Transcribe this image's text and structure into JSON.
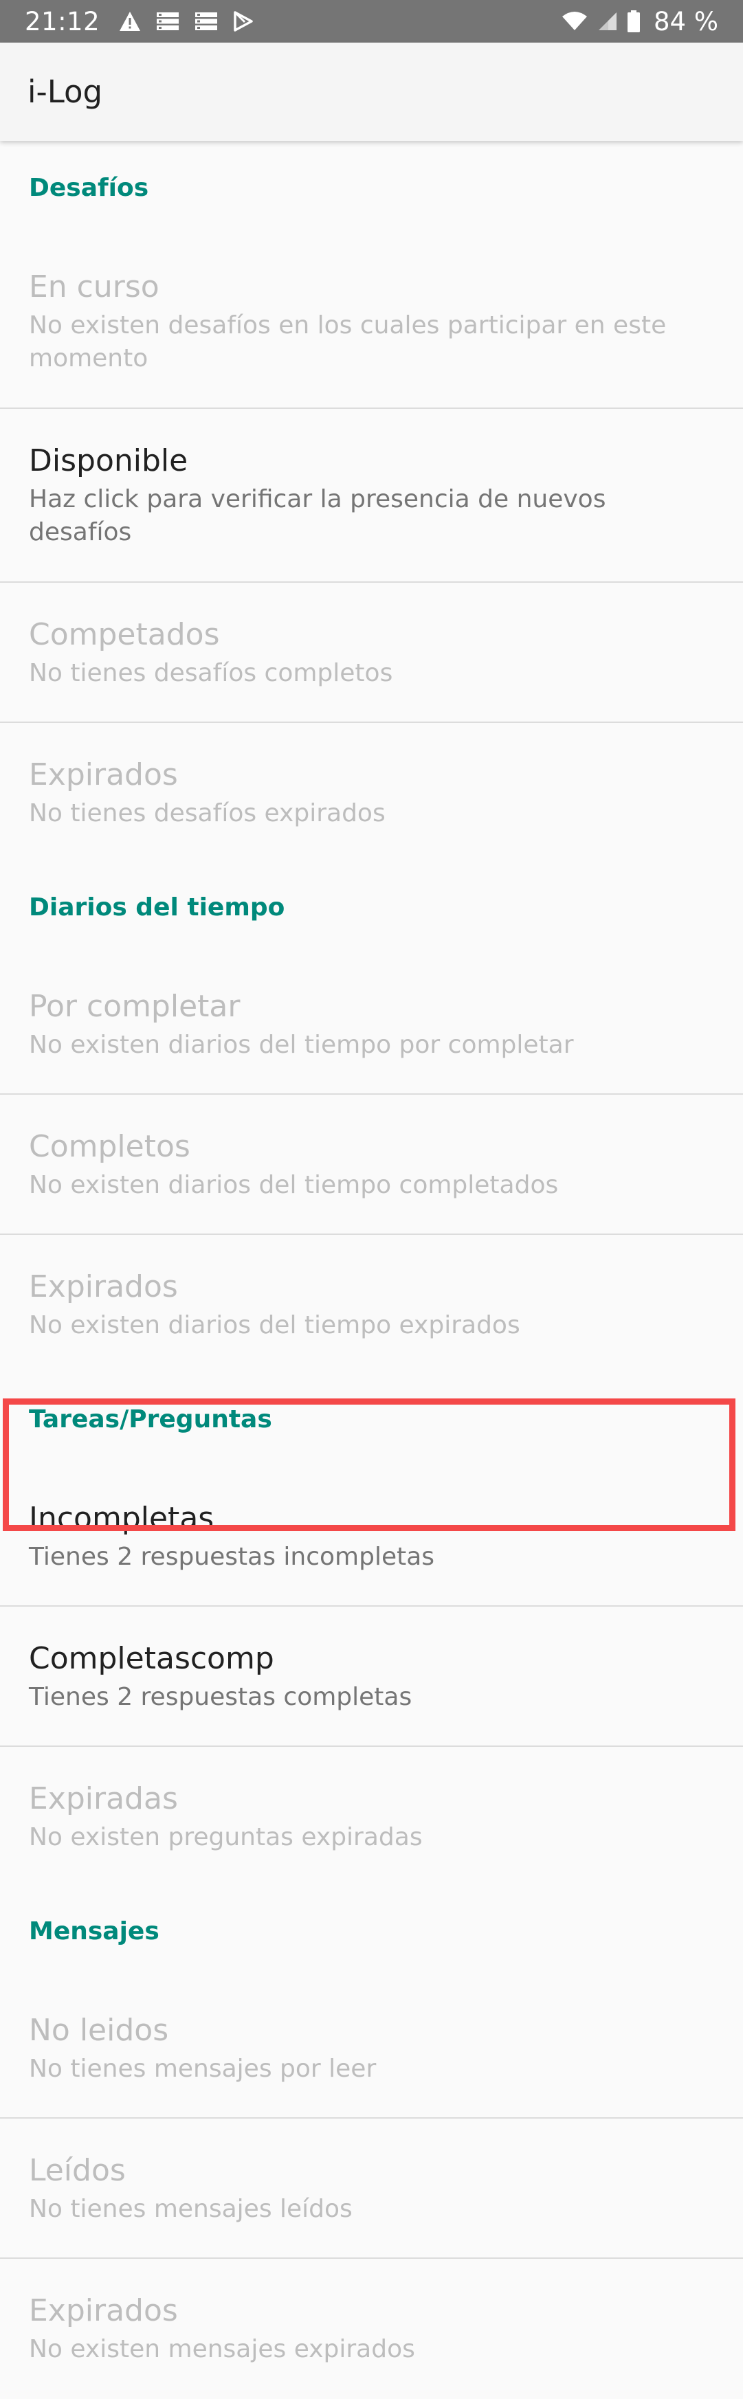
{
  "status_bar": {
    "time": "21:12",
    "battery": "84 %",
    "icons": [
      "warning-icon",
      "sim-icon",
      "sim-icon",
      "play-store-icon",
      "wifi-icon",
      "signal-icon",
      "battery-icon"
    ]
  },
  "app_bar": {
    "title": "i-Log"
  },
  "sections": {
    "challenges": {
      "header": "Desafíos",
      "in_progress": {
        "title": "En curso",
        "summary": "No existen desafíos en los cuales participar en este momento"
      },
      "available": {
        "title": "Disponible",
        "summary": "Haz click para verificar la presencia de nuevos desafíos"
      },
      "completed": {
        "title": "Competados",
        "summary": "No tienes desafíos completos"
      },
      "expired": {
        "title": "Expirados",
        "summary": "No tienes desafíos expirados"
      }
    },
    "time_diaries": {
      "header": "Diarios del tiempo",
      "to_complete": {
        "title": "Por completar",
        "summary": "No existen diarios del tiempo por completar"
      },
      "completed": {
        "title": "Completos",
        "summary": "No existen diarios del tiempo completados"
      },
      "expired": {
        "title": "Expirados",
        "summary": "No existen diarios del tiempo expirados"
      }
    },
    "tasks": {
      "header": "Tareas/Preguntas",
      "incomplete": {
        "title": "Incompletas",
        "summary": "Tienes 2 respuestas incompletas"
      },
      "complete": {
        "title": "Completascomp",
        "summary": "Tienes 2 respuestas completas"
      },
      "expired": {
        "title": "Expiradas",
        "summary": "No existen preguntas expiradas"
      }
    },
    "messages": {
      "header": "Mensajes",
      "unread": {
        "title": "No leidos",
        "summary": "No tienes mensajes por leer"
      },
      "read": {
        "title": "Leídos",
        "summary": "No tienes mensajes leídos"
      },
      "expired": {
        "title": "Expirados",
        "summary": "No existen mensajes expirados"
      }
    }
  },
  "colors": {
    "accent": "#00897b",
    "highlight": "#f44848",
    "status_bar": "#757575",
    "disabled_text": "#bdbdbd"
  }
}
